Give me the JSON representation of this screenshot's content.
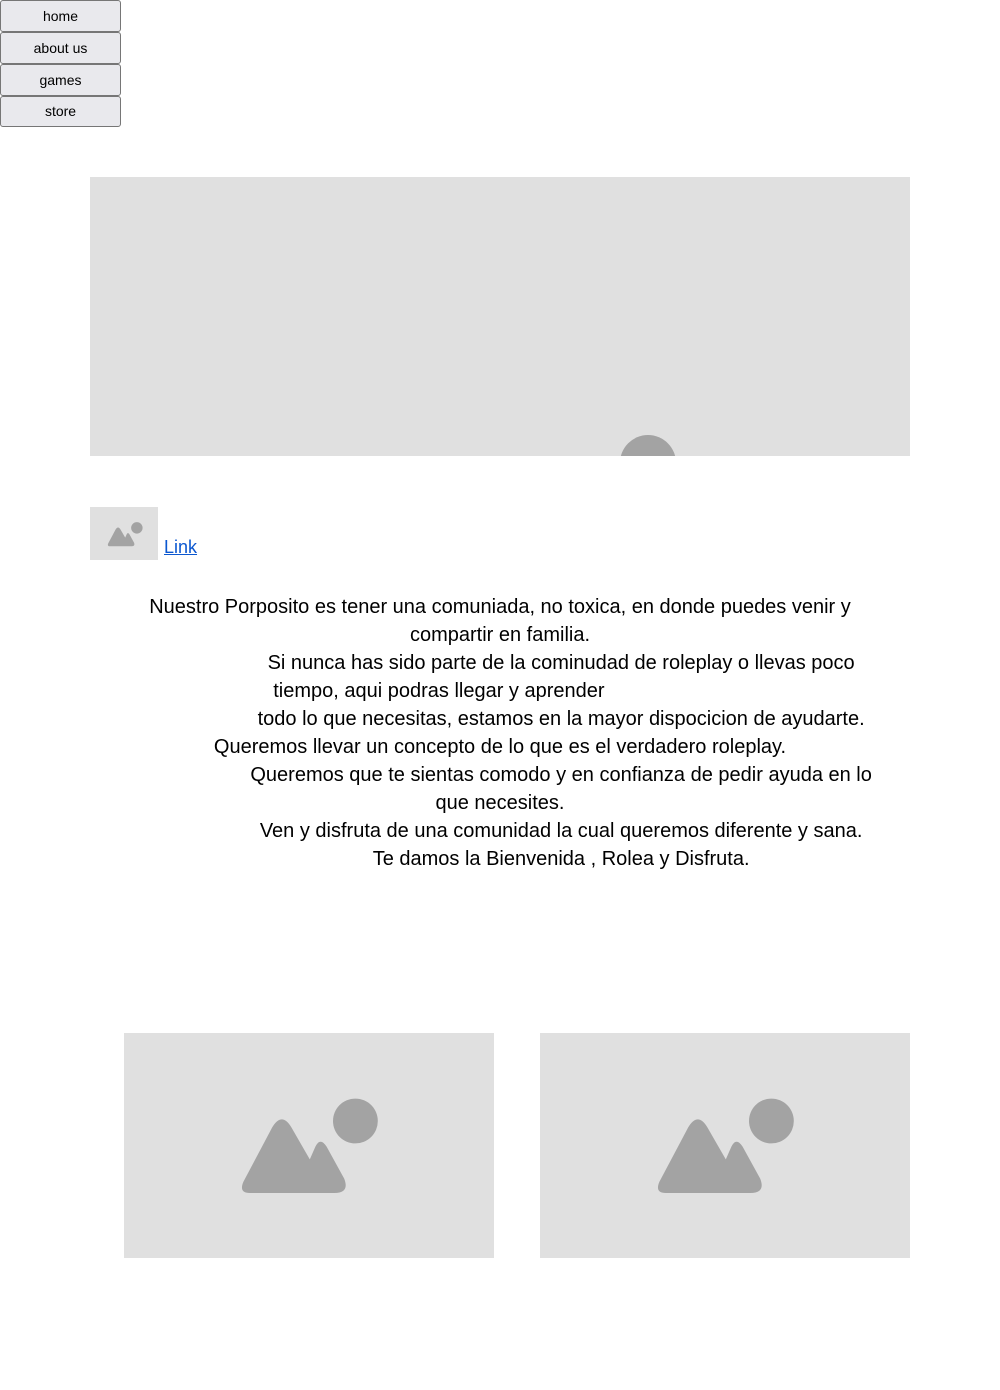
{
  "nav": {
    "items": [
      {
        "label": "home"
      },
      {
        "label": "about us"
      },
      {
        "label": "games"
      },
      {
        "label": "store"
      }
    ]
  },
  "images": {
    "hero_icon": "image-placeholder-icon",
    "thumb_icon": "image-placeholder-icon",
    "card_icon": "image-placeholder-icon",
    "placeholder_bg": "#e0e0e0",
    "placeholder_fg": "#a3a3a3"
  },
  "link": {
    "label": "Link",
    "color": "#0b57d0"
  },
  "intro": {
    "text": "Nuestro Porposito es tener una comuniada, no toxica, en donde puedes venir y compartir en familia.\n                      Si nunca has sido parte de la cominudad de roleplay o llevas poco tiempo, aqui podras llegar y aprender                      \n                      todo lo que necesitas, estamos en la mayor dispocicion de ayudarte. Queremos llevar un concepto de lo que es el verdadero roleplay.\n                      Queremos que te sientas comodo y en confianza de pedir ayuda en lo que necesites.\n                      Ven y disfruta de una comunidad la cual queremos diferente y sana.\n                      Te damos la Bienvenida , Rolea y Disfruta."
  }
}
